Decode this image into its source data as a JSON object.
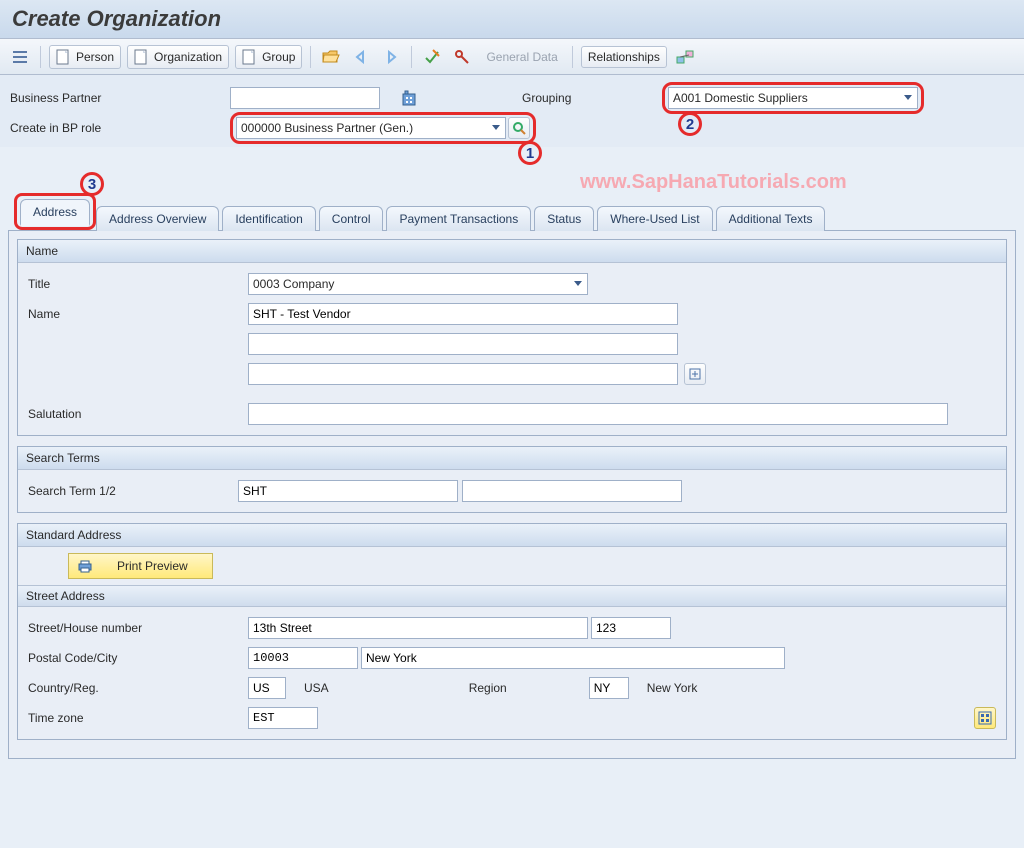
{
  "title": "Create Organization",
  "toolbar": {
    "person_label": "Person",
    "organization_label": "Organization",
    "group_label": "Group",
    "general_data_label": "General Data",
    "relationships_label": "Relationships"
  },
  "header": {
    "business_partner_label": "Business Partner",
    "business_partner_value": "",
    "grouping_label": "Grouping",
    "grouping_value": "A001 Domestic Suppliers",
    "create_bp_role_label": "Create in BP role",
    "create_bp_role_value": "000000 Business Partner (Gen.)"
  },
  "watermark": "www.SapHanaTutorials.com",
  "annotations": {
    "one": "1",
    "two": "2",
    "three": "3"
  },
  "tabs": {
    "address": "Address",
    "address_overview": "Address Overview",
    "identification": "Identification",
    "control": "Control",
    "payment_transactions": "Payment Transactions",
    "status": "Status",
    "where_used": "Where-Used List",
    "additional_texts": "Additional Texts"
  },
  "name_group": {
    "header": "Name",
    "title_label": "Title",
    "title_value": "0003 Company",
    "name_label": "Name",
    "name_value": "SHT - Test Vendor",
    "name2_value": "",
    "name3_value": "",
    "salutation_label": "Salutation",
    "salutation_value": ""
  },
  "search_group": {
    "header": "Search Terms",
    "term_label": "Search Term 1/2",
    "term1_value": "SHT",
    "term2_value": ""
  },
  "address_group": {
    "header": "Standard Address",
    "print_preview_label": "Print Preview",
    "street_header": "Street Address",
    "street_label": "Street/House number",
    "street_value": "13th Street",
    "house_value": "123",
    "postal_label": "Postal Code/City",
    "postal_value": "10003",
    "city_value": "New York",
    "country_label": "Country/Reg.",
    "country_value": "US",
    "country_desc": "USA",
    "region_label": "Region",
    "region_value": "NY",
    "region_desc": "New York",
    "timezone_label": "Time zone",
    "timezone_value": "EST"
  }
}
